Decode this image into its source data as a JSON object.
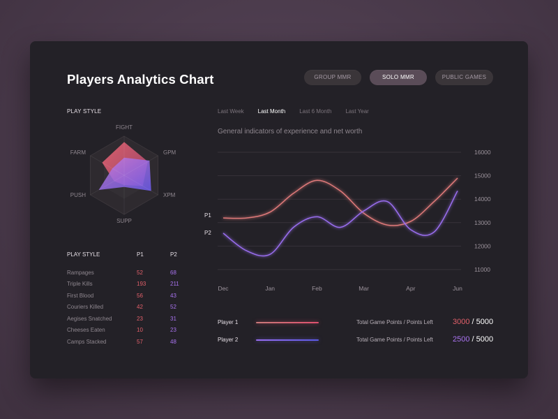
{
  "title": "Players Analytics Chart",
  "tabs": [
    {
      "label": "GROUP MMR",
      "active": false
    },
    {
      "label": "SOLO MMR",
      "active": true
    },
    {
      "label": "PUBLIC GAMES",
      "active": false
    }
  ],
  "radar_section_label": "PLAY STYLE",
  "radar": {
    "axes": [
      "FIGHT",
      "GPM",
      "XPM",
      "SUPP",
      "PUSH",
      "FARM"
    ],
    "p1": [
      0.85,
      0.7,
      0.55,
      0.25,
      0.3,
      0.65
    ],
    "p2": [
      0.45,
      0.75,
      0.8,
      0.3,
      0.75,
      0.35
    ]
  },
  "stats": {
    "header": {
      "name": "PLAY STYLE",
      "p1": "P1",
      "p2": "P2"
    },
    "rows": [
      {
        "name": "Rampages",
        "p1": "52",
        "p2": "68"
      },
      {
        "name": "Triple Kills",
        "p1": "193",
        "p2": "211"
      },
      {
        "name": "First Blood",
        "p1": "56",
        "p2": "43"
      },
      {
        "name": "Couriers Killed",
        "p1": "42",
        "p2": "52"
      },
      {
        "name": "Aegises Snatched",
        "p1": "23",
        "p2": "31"
      },
      {
        "name": "Cheeses Eaten",
        "p1": "10",
        "p2": "23"
      },
      {
        "name": "Camps Stacked",
        "p1": "57",
        "p2": "48"
      }
    ]
  },
  "periods": [
    {
      "label": "Last Week",
      "active": false
    },
    {
      "label": "Last Month",
      "active": true
    },
    {
      "label": "Last 6 Month",
      "active": false
    },
    {
      "label": "Last Year",
      "active": false
    }
  ],
  "subtitle": "General indicators of experience and net worth",
  "chart_data": {
    "type": "line",
    "categories": [
      "Dec",
      "Jan",
      "Feb",
      "Mar",
      "Apr",
      "Jun"
    ],
    "y_ticks": [
      "16000",
      "15000",
      "14000",
      "13000",
      "12000",
      "11000"
    ],
    "ylim": [
      11000,
      16000
    ],
    "grid": true,
    "series": [
      {
        "name": "P1",
        "color": "#e07a7a",
        "x": [
          0,
          0.5,
          1,
          1.5,
          2,
          2.5,
          3,
          3.5,
          4,
          4.5,
          5
        ],
        "y": [
          13200,
          13200,
          13450,
          14250,
          14800,
          14350,
          13400,
          12900,
          13050,
          13900,
          14900
        ]
      },
      {
        "name": "P2",
        "color": "#9a6ef0",
        "x": [
          0,
          0.5,
          1,
          1.5,
          2,
          2.5,
          3,
          3.5,
          4,
          4.5,
          5
        ],
        "y": [
          12550,
          11800,
          11650,
          12800,
          13250,
          12800,
          13500,
          13900,
          12700,
          12600,
          14350
        ]
      }
    ]
  },
  "legend": {
    "player1": "Player 1",
    "player2": "Player 2",
    "points_label": "Total Game Points / Points Left",
    "p1_points": "3000",
    "p2_points": "2500",
    "separator": "/",
    "total": "5000"
  }
}
